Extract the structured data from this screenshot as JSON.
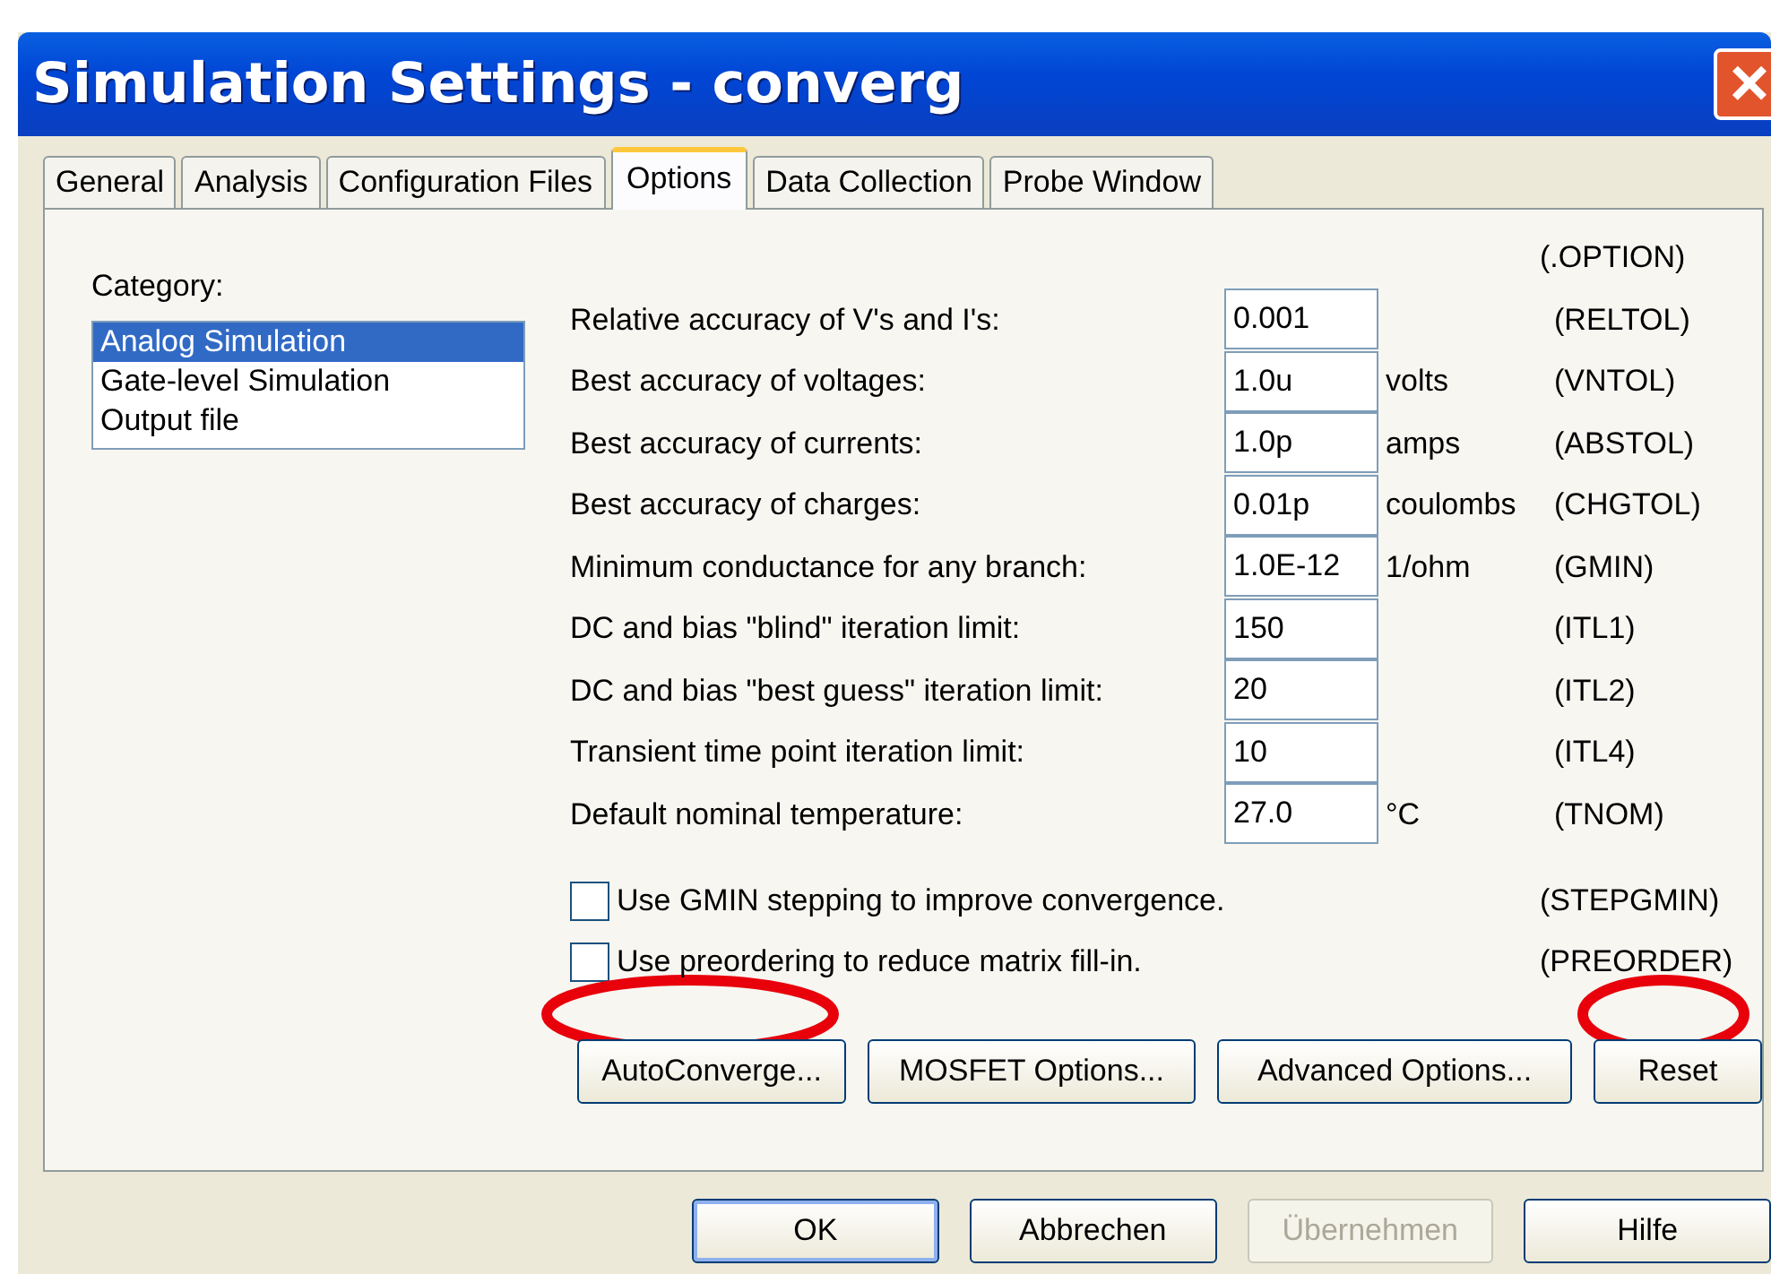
{
  "window": {
    "title": "Simulation Settings - converg",
    "close": "×"
  },
  "tabs": [
    {
      "label": "General",
      "selected": false
    },
    {
      "label": "Analysis",
      "selected": false
    },
    {
      "label": "Configuration Files",
      "selected": false
    },
    {
      "label": "Options",
      "selected": true
    },
    {
      "label": "Data Collection",
      "selected": false
    },
    {
      "label": "Probe Window",
      "selected": false
    }
  ],
  "option_header": "(.OPTION)",
  "category": {
    "label": "Category:",
    "items": [
      {
        "label": "Analog Simulation",
        "selected": true
      },
      {
        "label": "Gate-level Simulation",
        "selected": false
      },
      {
        "label": "Output file",
        "selected": false
      }
    ]
  },
  "options": [
    {
      "label": "Relative accuracy of V's and I's:",
      "value": "0.001",
      "code": "(RELTOL)"
    },
    {
      "label": "Best accuracy of voltages:",
      "value": "1.0u",
      "unit": "volts",
      "code": "(VNTOL)"
    },
    {
      "label": "Best accuracy of currents:",
      "value": "1.0p",
      "unit": "amps",
      "code": "(ABSTOL)"
    },
    {
      "label": "Best accuracy of charges:",
      "value": "0.01p",
      "unit": "coulombs",
      "code": "(CHGTOL)"
    },
    {
      "label": "Minimum conductance for any branch:",
      "value": "1.0E-12",
      "unit": "1/ohm",
      "code": "(GMIN)"
    },
    {
      "label": "DC and bias \"blind\" iteration limit:",
      "value": "150",
      "code": "(ITL1)"
    },
    {
      "label": "DC and bias \"best guess\" iteration limit:",
      "value": "20",
      "code": "(ITL2)"
    },
    {
      "label": "Transient time point iteration limit:",
      "value": "10",
      "code": "(ITL4)"
    },
    {
      "label": "Default nominal temperature:",
      "value": "27.0",
      "unit": "°C",
      "code": "(TNOM)"
    }
  ],
  "checkboxes": [
    {
      "label": "Use GMIN stepping to improve convergence.",
      "checked": false,
      "code": "(STEPGMIN)"
    },
    {
      "label": "Use preordering to reduce matrix fill-in.",
      "checked": false,
      "code": "(PREORDER)"
    }
  ],
  "panel_buttons": [
    {
      "label": "AutoConverge..."
    },
    {
      "label": "MOSFET Options..."
    },
    {
      "label": "Advanced Options..."
    },
    {
      "label": "Reset"
    }
  ],
  "dialog_buttons": [
    {
      "label": "OK",
      "disabled": false,
      "default": true
    },
    {
      "label": "Abbrechen",
      "disabled": false,
      "default": false
    },
    {
      "label": "Übernehmen",
      "disabled": true,
      "default": false
    },
    {
      "label": "Hilfe",
      "disabled": false,
      "default": false
    }
  ]
}
